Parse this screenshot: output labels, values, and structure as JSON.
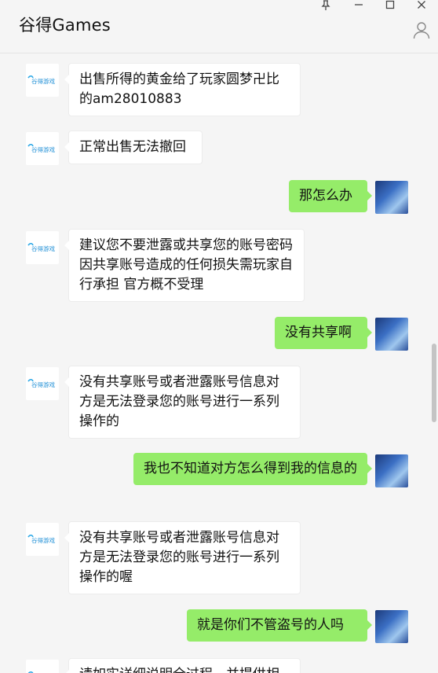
{
  "window": {
    "title": "谷得Games"
  },
  "controls": {
    "pin": "⊥",
    "minimize": "—",
    "maximize": "□",
    "close": "✕"
  },
  "bot": {
    "logo_text": "谷得游戏"
  },
  "messages": [
    {
      "side": "left",
      "text": "出售所得的黄金给了玩家圆梦卍比的am28010883"
    },
    {
      "side": "left",
      "text": "正常出售无法撤回"
    },
    {
      "side": "right",
      "text": "那怎么办"
    },
    {
      "side": "left",
      "text": "建议您不要泄露或共享您的账号密码 因共享账号造成的任何损失需玩家自行承担 官方概不受理"
    },
    {
      "side": "right",
      "text": "没有共享啊"
    },
    {
      "side": "left",
      "text": "没有共享账号或者泄露账号信息对方是无法登录您的账号进行一系列操作的"
    },
    {
      "side": "right",
      "text": "我也不知道对方怎么得到我的信息的"
    },
    {
      "side": "left",
      "text": "没有共享账号或者泄露账号信息对方是无法登录您的账号进行一系列操作的喔"
    },
    {
      "side": "right",
      "text": "就是你们不管盗号的人吗"
    },
    {
      "side": "left",
      "text": "请如实详细说明全过程，并提供相"
    }
  ],
  "colors": {
    "self_bubble": "#95ec69",
    "other_bubble": "#ffffff",
    "background": "#f5f5f5"
  }
}
